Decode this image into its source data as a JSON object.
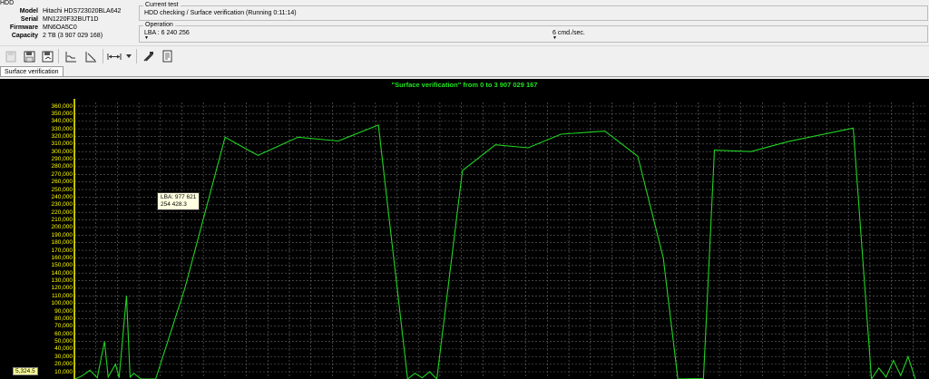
{
  "hdd": {
    "title": "HDD",
    "rows": [
      {
        "label": "Model",
        "value": "Hitachi HDS723020BLA642"
      },
      {
        "label": "Serial",
        "value": "MN1220F32BUT1D"
      },
      {
        "label": "Firmware",
        "value": "MN6OA5C0"
      },
      {
        "label": "Capacity",
        "value": "2 TB (3 907 029 168)"
      }
    ]
  },
  "current_test": {
    "legend": "Current test",
    "text": "HDD checking / Surface verification (Running 0:11:14)"
  },
  "operation": {
    "legend": "Operation",
    "lba": "LBA : 6 240 256",
    "speed": "6 cmd./sec."
  },
  "toolbar": {
    "icons": [
      "disk-disabled-icon",
      "disk-save-icon",
      "disk-open-icon",
      "chart-line-icon",
      "chart-slope-icon",
      "range-arrows-icon",
      "dropdown-arrow-icon",
      "tools-icon",
      "report-icon"
    ]
  },
  "tab": {
    "label": "Surface verification"
  },
  "chart_data": {
    "type": "line",
    "title": "\"Surface verification\" from 0 to 3 907 029 167",
    "ylim": [
      0,
      370000
    ],
    "y_ticks": [
      "360,000",
      "350,000",
      "340,000",
      "330,000",
      "320,000",
      "310,000",
      "300,000",
      "290,000",
      "280,000",
      "270,000",
      "260,000",
      "250,000",
      "240,000",
      "230,000",
      "220,000",
      "210,000",
      "200,000",
      "190,000",
      "180,000",
      "170,000",
      "160,000",
      "150,000",
      "140,000",
      "130,000",
      "120,000",
      "110,000",
      "100,000",
      "90,000",
      "80,000",
      "70,000",
      "60,000",
      "50,000",
      "40,000",
      "30,000",
      "20,000",
      "10,000"
    ],
    "grid": true,
    "colors": {
      "line": "#21d321",
      "axis": "#ffff00",
      "grid": "#6a6a6a",
      "title": "#21e321"
    },
    "tooltip": {
      "line1": "LBA: 977 621",
      "line2": "254 428.3"
    },
    "cursor_value": "5,324.5",
    "series": [
      {
        "values": [
          [
            0,
            0
          ],
          [
            2,
            5000
          ],
          [
            4,
            12000
          ],
          [
            6,
            2000
          ],
          [
            8,
            50000
          ],
          [
            9,
            3000
          ],
          [
            11,
            20000
          ],
          [
            12,
            2000
          ],
          [
            14,
            110000
          ],
          [
            15,
            3000
          ],
          [
            16,
            8000
          ],
          [
            18,
            0
          ],
          [
            22,
            0
          ],
          [
            30,
            120000
          ],
          [
            41,
            319000
          ],
          [
            50,
            295000
          ],
          [
            61,
            319000
          ],
          [
            72,
            314000
          ],
          [
            83,
            335000
          ],
          [
            91,
            0
          ],
          [
            93,
            8000
          ],
          [
            95,
            2000
          ],
          [
            97,
            10000
          ],
          [
            99,
            0
          ],
          [
            106,
            275000
          ],
          [
            115,
            309000
          ],
          [
            124,
            305000
          ],
          [
            133,
            323000
          ],
          [
            145,
            327000
          ],
          [
            154,
            294000
          ],
          [
            161,
            160000
          ],
          [
            165,
            0
          ],
          [
            172,
            1000
          ],
          [
            175,
            302000
          ],
          [
            185,
            300000
          ],
          [
            195,
            313000
          ],
          [
            213,
            331000
          ],
          [
            218,
            0
          ],
          [
            220,
            15000
          ],
          [
            222,
            3000
          ],
          [
            224,
            25000
          ],
          [
            226,
            5000
          ],
          [
            228,
            30000
          ],
          [
            230,
            0
          ]
        ]
      }
    ]
  }
}
